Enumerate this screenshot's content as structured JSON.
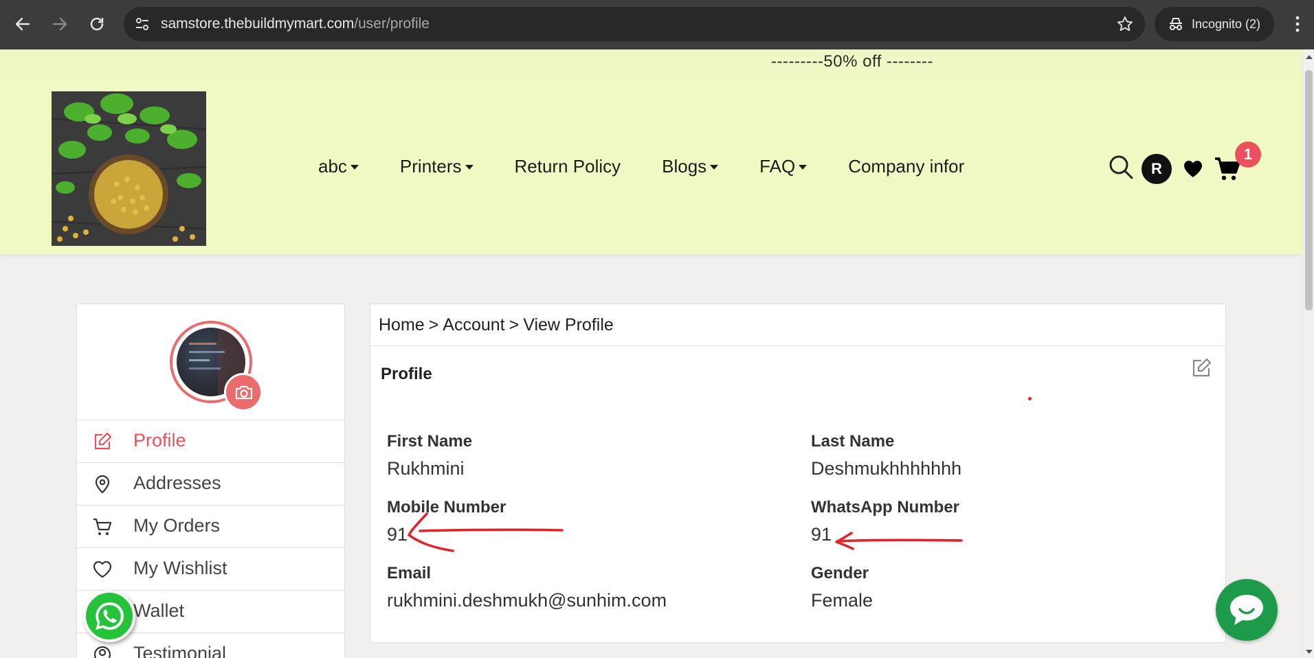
{
  "browser": {
    "url_host": "samstore.thebuildmymart.com",
    "url_path": "/user/profile",
    "incognito_label": "Incognito (2)"
  },
  "header": {
    "promo": "---------50% off --------",
    "nav": [
      {
        "label": "abc",
        "dropdown": true
      },
      {
        "label": "Printers",
        "dropdown": true
      },
      {
        "label": "Return Policy",
        "dropdown": false
      },
      {
        "label": "Blogs",
        "dropdown": true
      },
      {
        "label": "FAQ",
        "dropdown": true
      },
      {
        "label": "Company infor",
        "dropdown": false
      }
    ],
    "avatar_initial": "R",
    "cart_count": "1"
  },
  "sidebar": {
    "items": [
      {
        "label": "Profile",
        "icon": "edit-icon",
        "active": true
      },
      {
        "label": "Addresses",
        "icon": "location-pin-icon"
      },
      {
        "label": "My Orders",
        "icon": "cart-icon"
      },
      {
        "label": "My Wishlist",
        "icon": "heart-icon"
      },
      {
        "label": "Wallet",
        "icon": "wallet-icon"
      },
      {
        "label": "Testimonial",
        "icon": "user-circle-icon"
      }
    ]
  },
  "breadcrumb": {
    "home": "Home",
    "sep": ">",
    "account": "Account",
    "current": "View Profile"
  },
  "profile": {
    "title": "Profile",
    "first_name_label": "First Name",
    "first_name": "Rukhmini",
    "last_name_label": "Last Name",
    "last_name": "Deshmukhhhhhhh",
    "mobile_label": "Mobile Number",
    "mobile": "91",
    "whatsapp_label": "WhatsApp Number",
    "whatsapp": "91",
    "email_label": "Email",
    "email": "rukhmini.deshmukh@sunhim.com",
    "gender_label": "Gender",
    "gender": "Female"
  },
  "colors": {
    "accent": "#e9525d",
    "header_bg": "#f0f9c4",
    "whatsapp_green": "#25c33a",
    "chat_green": "#1e9b4a",
    "annotation_red": "#e0242a"
  }
}
